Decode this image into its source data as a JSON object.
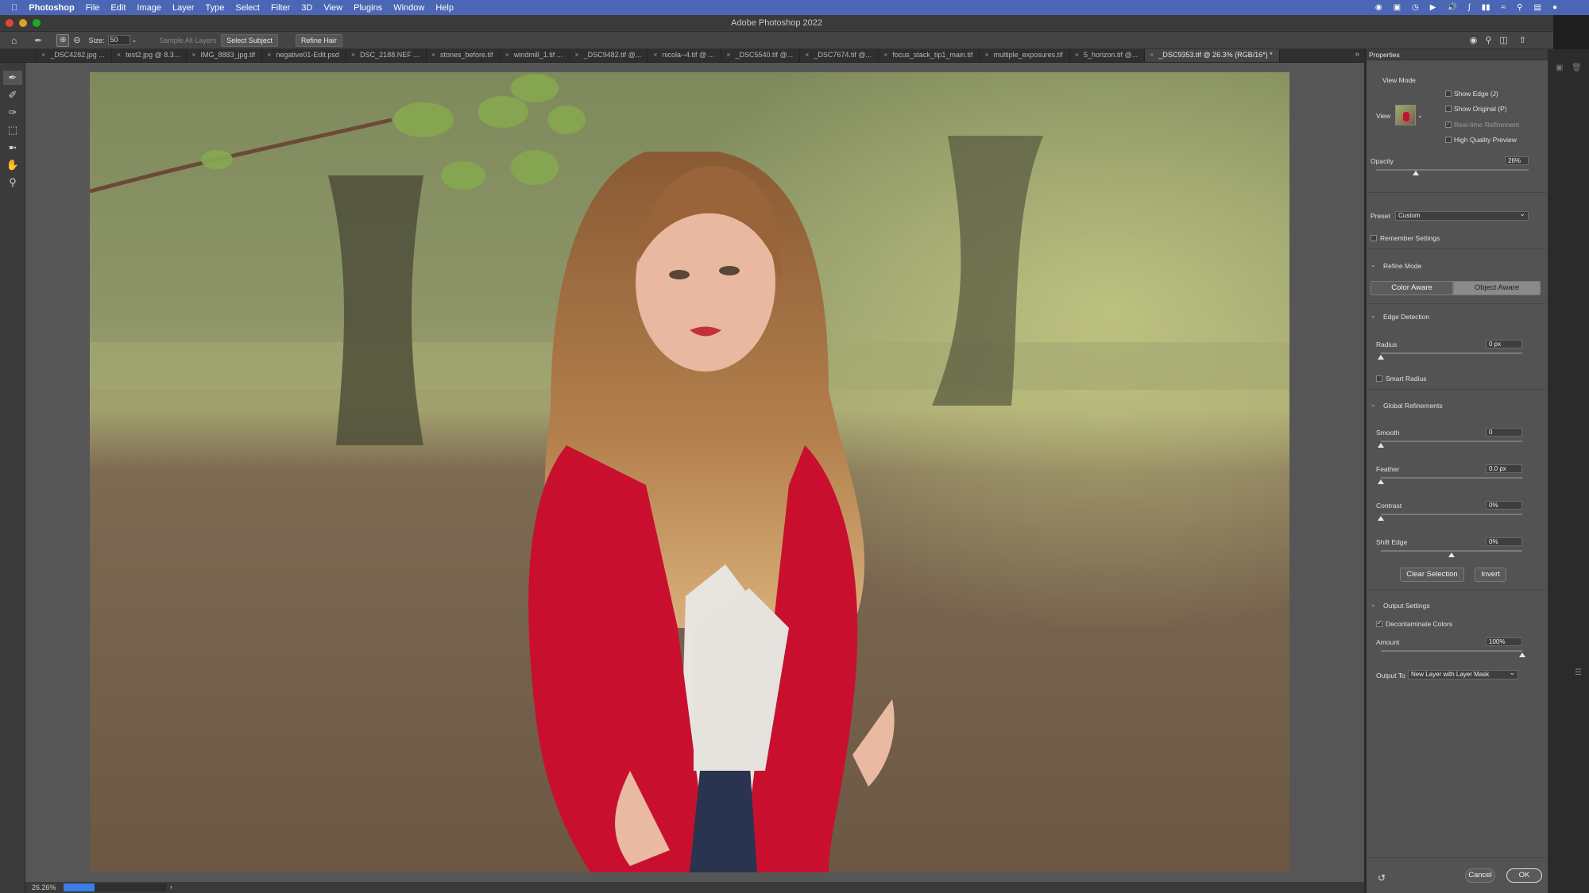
{
  "menubar": {
    "app_name": "Photoshop",
    "items": [
      "File",
      "Edit",
      "Image",
      "Layer",
      "Type",
      "Select",
      "Filter",
      "3D",
      "View",
      "Plugins",
      "Window",
      "Help"
    ]
  },
  "window": {
    "title": "Adobe Photoshop 2022"
  },
  "options_bar": {
    "size_label": "Size:",
    "size_value": "50",
    "sample_all_layers": "Sample All Layers",
    "select_subject": "Select Subject",
    "refine_hair": "Refine Hair"
  },
  "tabs": [
    "_DSC4282.jpg ...",
    "test2.jpg @ 8.3...",
    "IMG_8883_jpg.tif",
    "negative01-Edit.psd",
    "DSC_2188.NEF ...",
    "stones_before.tif",
    "windmill_1.tif ...",
    "_DSC9482.tif @...",
    "nicola--4.tif @ ...",
    "_DSC5540.tif @...",
    "_DSC7674.tif @...",
    "focus_stack_tip1_main.tif",
    "multiple_exposures.tif",
    "5_horizon.tif @...",
    "_DSC9353.tif @ 26.3% (RGB/16*) *"
  ],
  "status": {
    "zoom": "26.26%",
    "progress": 0.3
  },
  "panel": {
    "title": "Properties",
    "view_mode": {
      "heading": "View Mode",
      "view_label": "View",
      "show_edge": "Show Edge (J)",
      "show_original": "Show Original (P)",
      "realtime": "Real-time Refinement",
      "high_quality": "High Quality Preview"
    },
    "opacity": {
      "label": "Opacity",
      "value": "26%",
      "level": 0.26
    },
    "preset": {
      "label": "Preset",
      "value": "Custom"
    },
    "remember": "Remember Settings",
    "refine_mode": {
      "heading": "Refine Mode",
      "color_aware": "Color Aware",
      "object_aware": "Object Aware"
    },
    "edge_detection": {
      "heading": "Edge Detection",
      "radius_label": "Radius",
      "radius_value": "0 px",
      "smart_radius": "Smart Radius"
    },
    "global": {
      "heading": "Global Refinements",
      "smooth_label": "Smooth",
      "smooth_value": "0",
      "feather_label": "Feather",
      "feather_value": "0.0 px",
      "contrast_label": "Contrast",
      "contrast_value": "0%",
      "shift_label": "Shift Edge",
      "shift_value": "0%",
      "clear_selection": "Clear Selection",
      "invert": "Invert"
    },
    "output": {
      "heading": "Output Settings",
      "decontaminate": "Decontaminate Colors",
      "amount_label": "Amount",
      "amount_value": "100%",
      "output_to_label": "Output To",
      "output_to_value": "New Layer with Layer Mask"
    },
    "cancel": "Cancel",
    "ok": "OK"
  }
}
